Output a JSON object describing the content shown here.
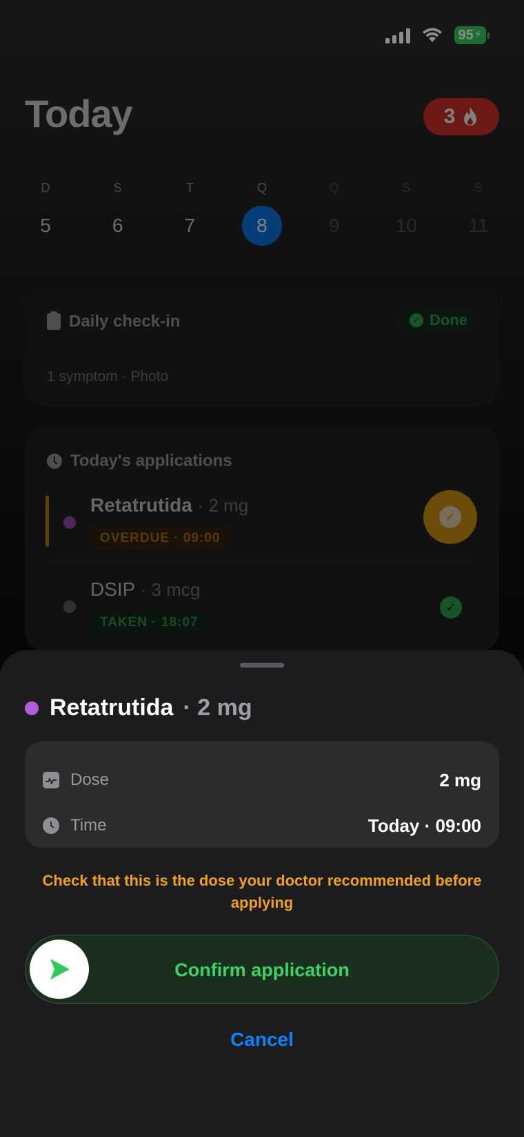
{
  "status_bar": {
    "battery": "95"
  },
  "header": {
    "title": "Today",
    "streak_count": "3"
  },
  "week": [
    {
      "letter": "D",
      "number": "5",
      "state": "past"
    },
    {
      "letter": "S",
      "number": "6",
      "state": "past"
    },
    {
      "letter": "T",
      "number": "7",
      "state": "past"
    },
    {
      "letter": "Q",
      "number": "8",
      "state": "selected"
    },
    {
      "letter": "Q",
      "number": "9",
      "state": "future"
    },
    {
      "letter": "S",
      "number": "10",
      "state": "future"
    },
    {
      "letter": "S",
      "number": "11",
      "state": "future"
    }
  ],
  "checkin": {
    "title": "Daily check-in",
    "status": "Done",
    "summary": "1 symptom · Photo"
  },
  "applications": {
    "title": "Today's applications",
    "items": [
      {
        "name": "Retatrutida",
        "dose": "· 2 mg",
        "status": "OVERDUE · 09:00",
        "dot_color": "#8e4aa6"
      },
      {
        "name": "DSIP",
        "dose": "· 3 mcg",
        "status": "TAKEN · 18:07",
        "dot_color": "#5a5a5e"
      }
    ]
  },
  "sheet": {
    "name": "Retatrutida",
    "dose_suffix": "· 2 mg",
    "dose_label": "Dose",
    "dose_value": "2 mg",
    "time_label": "Time",
    "time_value": "Today · 09:00",
    "warning": "Check that this is the dose your doctor recommended before applying",
    "confirm_label": "Confirm application",
    "cancel_label": "Cancel"
  },
  "colors": {
    "accent": "#0a84ff",
    "confirm": "#3fd265",
    "warning": "#f0a020",
    "overdue": "#c48a12"
  }
}
